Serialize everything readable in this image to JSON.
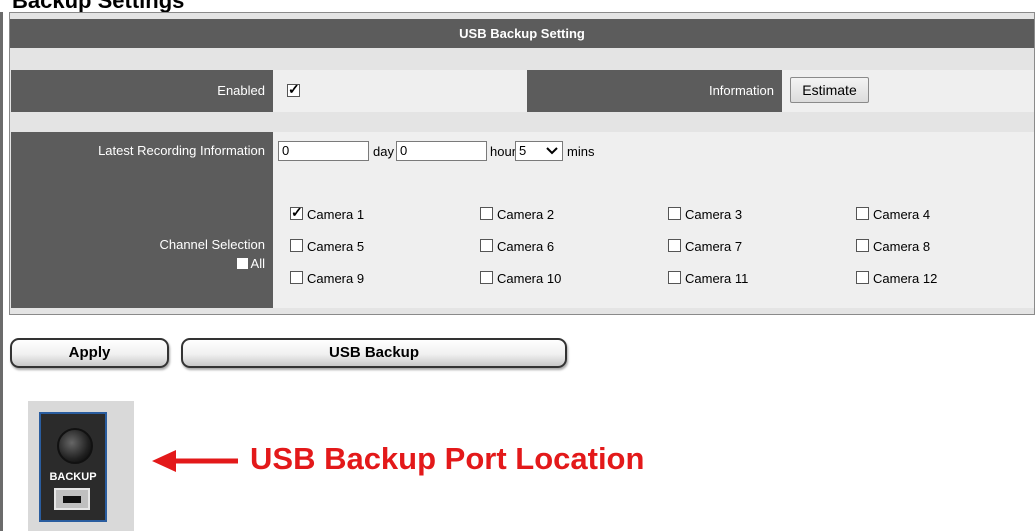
{
  "window": {
    "heading": "Backup Settings",
    "title": "USB Backup Setting"
  },
  "enabled_row": {
    "label": "Enabled",
    "checked": true,
    "info_label": "Information",
    "estimate_button": "Estimate"
  },
  "recording_row": {
    "label": "Latest Recording Information",
    "day_value": "0",
    "day_unit": "day",
    "hour_value": "0",
    "hour_unit": "hour",
    "mins_value": "5",
    "mins_unit": "mins"
  },
  "channel_row": {
    "label": "Channel Selection",
    "all_label": "All",
    "all_checked": false,
    "cameras": [
      {
        "label": "Camera 1",
        "checked": true
      },
      {
        "label": "Camera 2",
        "checked": false
      },
      {
        "label": "Camera 3",
        "checked": false
      },
      {
        "label": "Camera 4",
        "checked": false
      },
      {
        "label": "Camera 5",
        "checked": false
      },
      {
        "label": "Camera 6",
        "checked": false
      },
      {
        "label": "Camera 7",
        "checked": false
      },
      {
        "label": "Camera 8",
        "checked": false
      },
      {
        "label": "Camera 9",
        "checked": false
      },
      {
        "label": "Camera 10",
        "checked": false
      },
      {
        "label": "Camera 11",
        "checked": false
      },
      {
        "label": "Camera 12",
        "checked": false
      }
    ]
  },
  "actions": {
    "apply_label": "Apply",
    "usb_backup_label": "USB Backup"
  },
  "annotation": {
    "device_label": "BACKUP",
    "callout_text": "USB Backup Port Location",
    "callout_color": "#e3191a"
  },
  "colors": {
    "header_gray": "#5c5c5c",
    "panel_bg": "#e4e4e4",
    "device_border": "#2a5d9f"
  }
}
